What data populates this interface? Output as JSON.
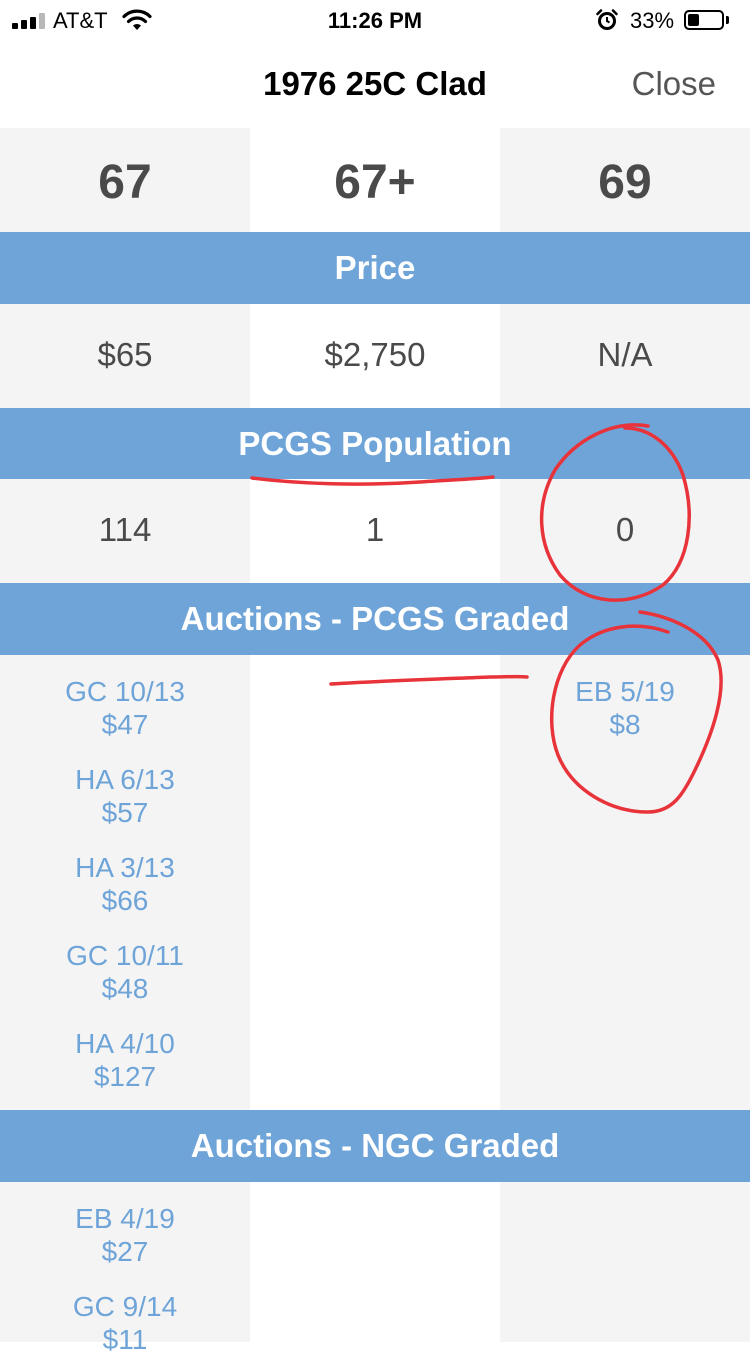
{
  "status_bar": {
    "carrier": "AT&T",
    "time": "11:26 PM",
    "battery_percent": "33%",
    "battery_level": 0.33,
    "signal_bars": 3,
    "signal_bars_total": 4
  },
  "nav": {
    "title": "1976 25C Clad",
    "close_label": "Close"
  },
  "grades": [
    "67",
    "67+",
    "69"
  ],
  "sections": {
    "price": {
      "title": "Price",
      "values": [
        "$65",
        "$2,750",
        "N/A"
      ]
    },
    "population": {
      "title": "PCGS Population",
      "values": [
        "114",
        "1",
        "0"
      ]
    },
    "auctions_pcgs": {
      "title": "Auctions - PCGS Graded",
      "columns": [
        [
          {
            "date": "GC 10/13",
            "price": "$47"
          },
          {
            "date": "HA 6/13",
            "price": "$57"
          },
          {
            "date": "HA 3/13",
            "price": "$66"
          },
          {
            "date": "GC 10/11",
            "price": "$48"
          },
          {
            "date": "HA 4/10",
            "price": "$127"
          }
        ],
        [],
        [
          {
            "date": "EB 5/19",
            "price": "$8"
          }
        ]
      ]
    },
    "auctions_ngc": {
      "title": "Auctions - NGC Graded",
      "columns": [
        [
          {
            "date": "EB 4/19",
            "price": "$27"
          },
          {
            "date": "GC 9/14",
            "price": "$11"
          }
        ],
        [],
        []
      ]
    }
  },
  "colors": {
    "header_blue": "#6fa4d9",
    "link_blue": "#6fa4d9",
    "cell_shade": "#f4f4f4",
    "annotation_red": "#e8333a",
    "value_text": "#4a4a4a"
  }
}
